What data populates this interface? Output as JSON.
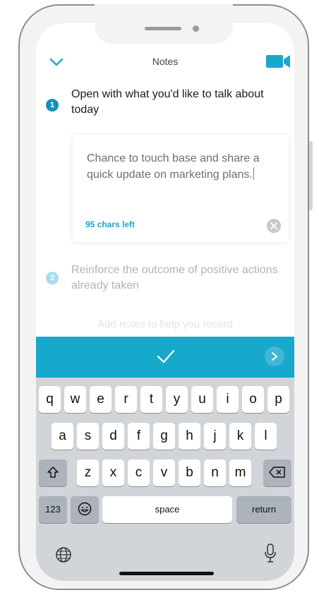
{
  "header": {
    "title": "Notes",
    "chevron_icon": "chevron-down-icon",
    "video_icon": "video-camera-icon"
  },
  "steps": [
    {
      "number": "1",
      "text": "Open with what you'd like to talk about today"
    },
    {
      "number": "2",
      "text": "Reinforce the outcome of positive actions already taken"
    }
  ],
  "note": {
    "value": "Chance to touch base and share a quick update on marketing plans.",
    "chars_left": "95 chars left"
  },
  "hint_text": "Add notes to help you record",
  "toolbar": {
    "confirm_icon": "checkmark-icon",
    "next_icon": "chevron-right-icon"
  },
  "keyboard": {
    "row1": [
      "q",
      "w",
      "e",
      "r",
      "t",
      "y",
      "u",
      "i",
      "o",
      "p"
    ],
    "row2": [
      "a",
      "s",
      "d",
      "f",
      "g",
      "h",
      "j",
      "k",
      "l"
    ],
    "row3": [
      "z",
      "x",
      "c",
      "v",
      "b",
      "n",
      "m"
    ],
    "numbers": "123",
    "space": "space",
    "return": "return"
  },
  "colors": {
    "accent": "#16a9cc",
    "step_active": "#1591b8",
    "step_inactive": "#a9dced"
  }
}
